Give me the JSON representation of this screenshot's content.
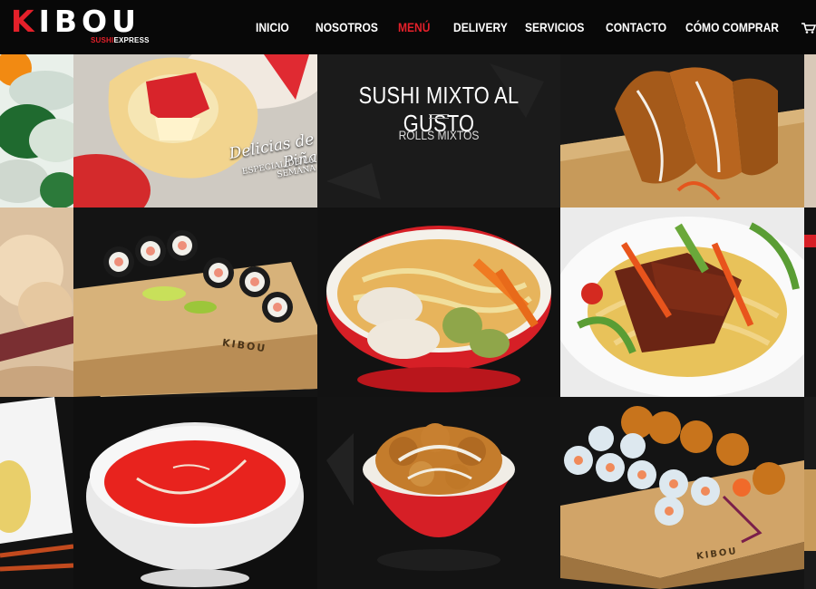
{
  "brand": {
    "name_first": "K",
    "name_rest": "IBOU",
    "tagline_red": "SUSHI",
    "tagline_white": "EXPRESS"
  },
  "nav": {
    "items": [
      {
        "label": "INICIO",
        "active": false
      },
      {
        "label": "NOSOTROS",
        "active": false
      },
      {
        "label": "MENÚ",
        "active": true
      },
      {
        "label": "DELIVERY",
        "active": false
      },
      {
        "label": "SERVICIOS",
        "active": false
      },
      {
        "label": "CONTACTO",
        "active": false
      },
      {
        "label": "CÓMO COMPRAR",
        "active": false
      }
    ],
    "cart_icon": "shopping-cart-icon"
  },
  "featured": {
    "title": "SUSHI MIXTO AL GUSTO",
    "subtitle": "ROLLS MIXTOS"
  },
  "promo": {
    "line1": "Delicias de Piña",
    "line2": "ESPECIAL DE LA SEMANA"
  },
  "board_brand": "KIBOU",
  "colors": {
    "accent": "#e4202a",
    "background": "#0c0c0c",
    "header": "#080808"
  }
}
